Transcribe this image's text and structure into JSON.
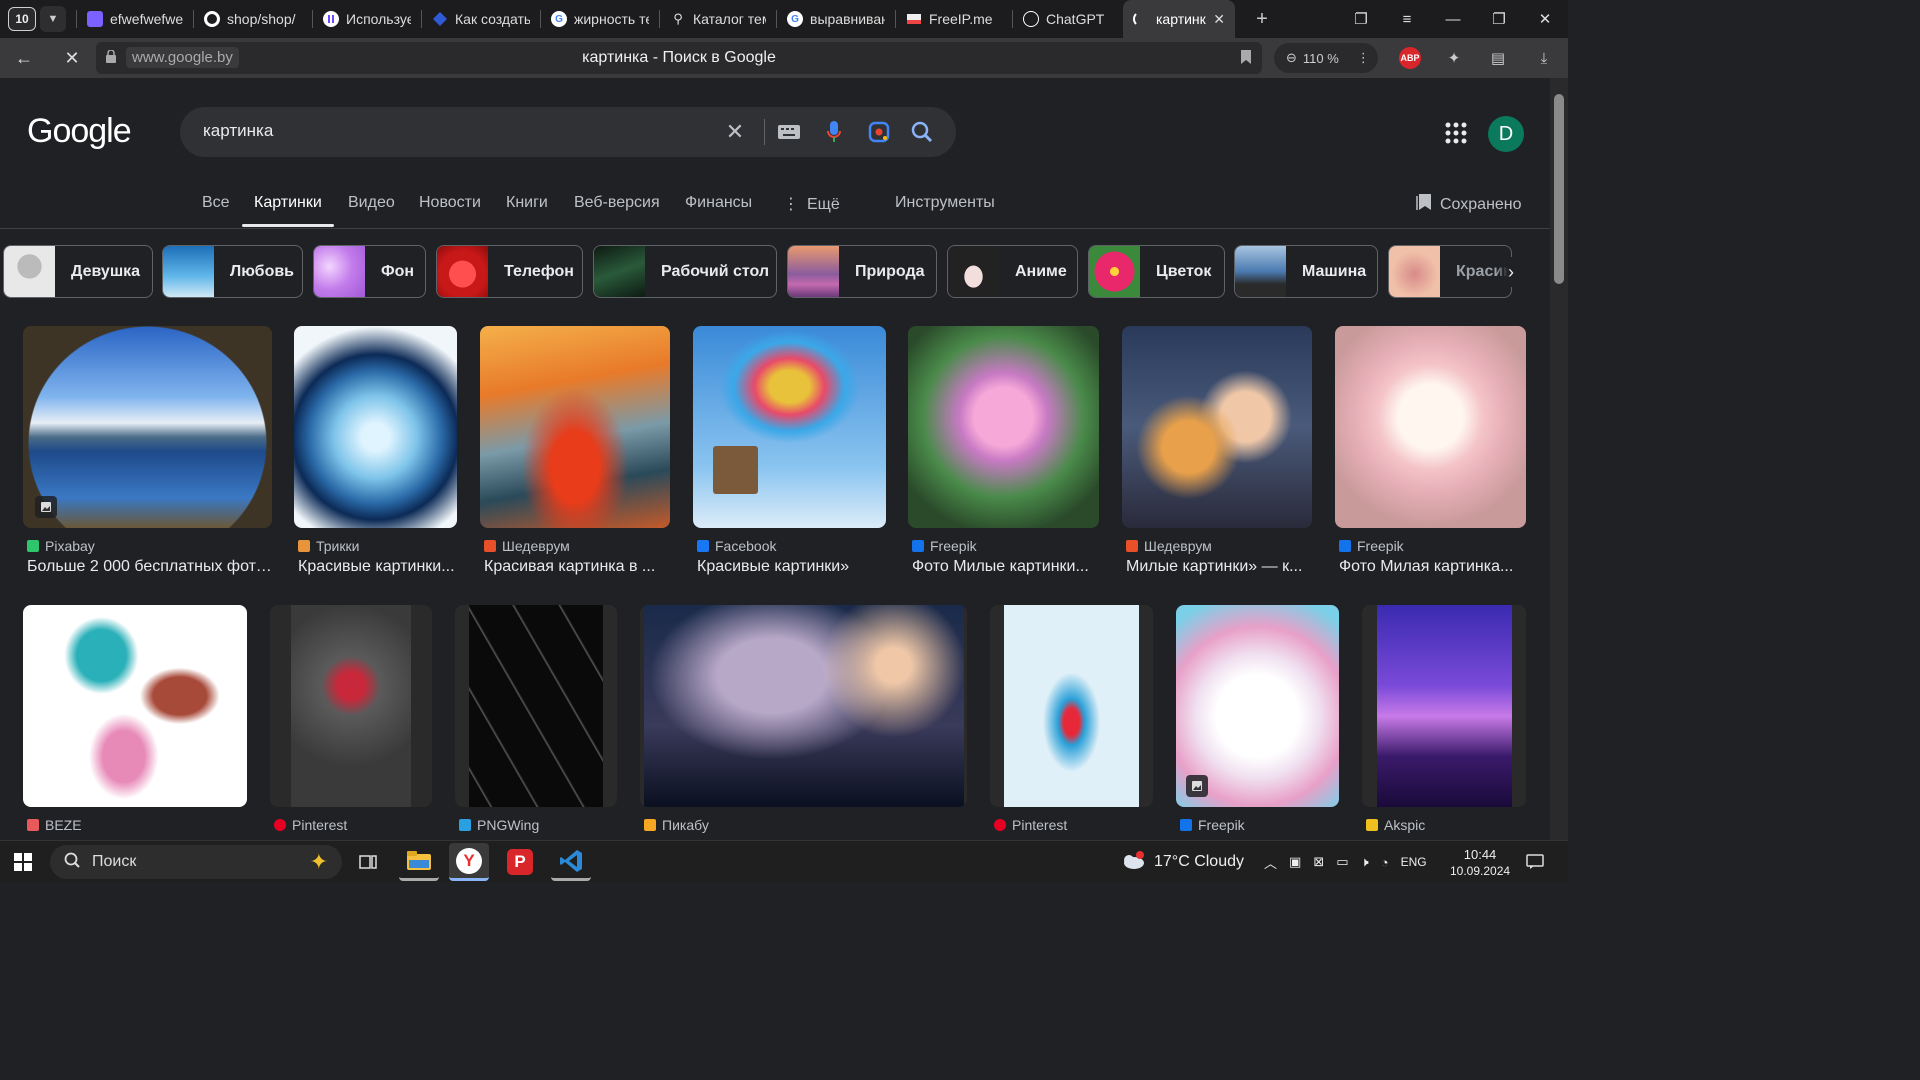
{
  "browser": {
    "tab_count": "10",
    "tabs": [
      {
        "title": "efwefwefwefwe",
        "icon": "purple-app-icon",
        "color": "#7b61ff"
      },
      {
        "title": "shop/shop/",
        "icon": "github-icon",
        "color": "#ffffff"
      },
      {
        "title": "Используем",
        "icon": "purple-circle-icon",
        "color": "#6d4aff"
      },
      {
        "title": "Как создать",
        "icon": "blue-diamond-icon",
        "color": "#2f5bd6"
      },
      {
        "title": "жирность текста",
        "icon": "google-icon",
        "color": "#ffffff"
      },
      {
        "title": "Каталог тем",
        "icon": "map-pin-icon",
        "color": "#dddddd"
      },
      {
        "title": "выравнивание",
        "icon": "google-icon",
        "color": "#ffffff"
      },
      {
        "title": "FreeIP.me",
        "icon": "freeip-icon",
        "color": "#e44"
      },
      {
        "title": "ChatGPT",
        "icon": "chatgpt-icon",
        "color": "#ffffff"
      },
      {
        "title": "картинка",
        "icon": "loading-icon",
        "color": "#ffffff"
      }
    ],
    "url_host": "www.google.by",
    "page_title": "картинка - Поиск в Google",
    "zoom": "110 %",
    "adblock_label": "ABP"
  },
  "google": {
    "logo": "Google",
    "query": "картинка",
    "avatar_letter": "D",
    "nav_tabs": [
      "Все",
      "Картинки",
      "Видео",
      "Новости",
      "Книги",
      "Веб-версия",
      "Финансы",
      "Ещё",
      "Инструменты"
    ],
    "saved_label": "Сохранено",
    "chips": [
      "Девушка",
      "Любовь",
      "Фон",
      "Телефон",
      "Рабочий стол",
      "Природа",
      "Аниме",
      "Цветок",
      "Машина",
      "Красивые"
    ],
    "results_row1": [
      {
        "source": "Pixabay",
        "title": "Больше 2 000 бесплатных фото...",
        "src_color": "#2ec66d"
      },
      {
        "source": "Трикки",
        "title": "Красивые картинки...",
        "src_color": "#e8943a"
      },
      {
        "source": "Шедеврум",
        "title": "Красивая картинка в ...",
        "src_color": "#e8502a"
      },
      {
        "source": "Facebook",
        "title": "Красивые картинки»",
        "src_color": "#1877f2"
      },
      {
        "source": "Freepik",
        "title": "Фото Милые картинки...",
        "src_color": "#1273eb"
      },
      {
        "source": "Шедеврум",
        "title": "Милые картинки» — к...",
        "src_color": "#e8502a"
      },
      {
        "source": "Freepik",
        "title": "Фото Милая картинка...",
        "src_color": "#1273eb"
      }
    ],
    "results_row2": [
      {
        "source": "BEZE",
        "src_color": "#e85a5a"
      },
      {
        "source": "Pinterest",
        "src_color": "#e60023"
      },
      {
        "source": "PNGWing",
        "src_color": "#2aa0e0"
      },
      {
        "source": "Пикабу",
        "src_color": "#f5a623"
      },
      {
        "source": "Pinterest",
        "src_color": "#e60023"
      },
      {
        "source": "Freepik",
        "src_color": "#1273eb"
      },
      {
        "source": "Akspic",
        "src_color": "#f0c020"
      }
    ]
  },
  "taskbar": {
    "search_label": "Поиск",
    "weather": "17°C  Cloudy",
    "lang": "ENG",
    "time": "10:44",
    "date": "10.09.2024"
  }
}
